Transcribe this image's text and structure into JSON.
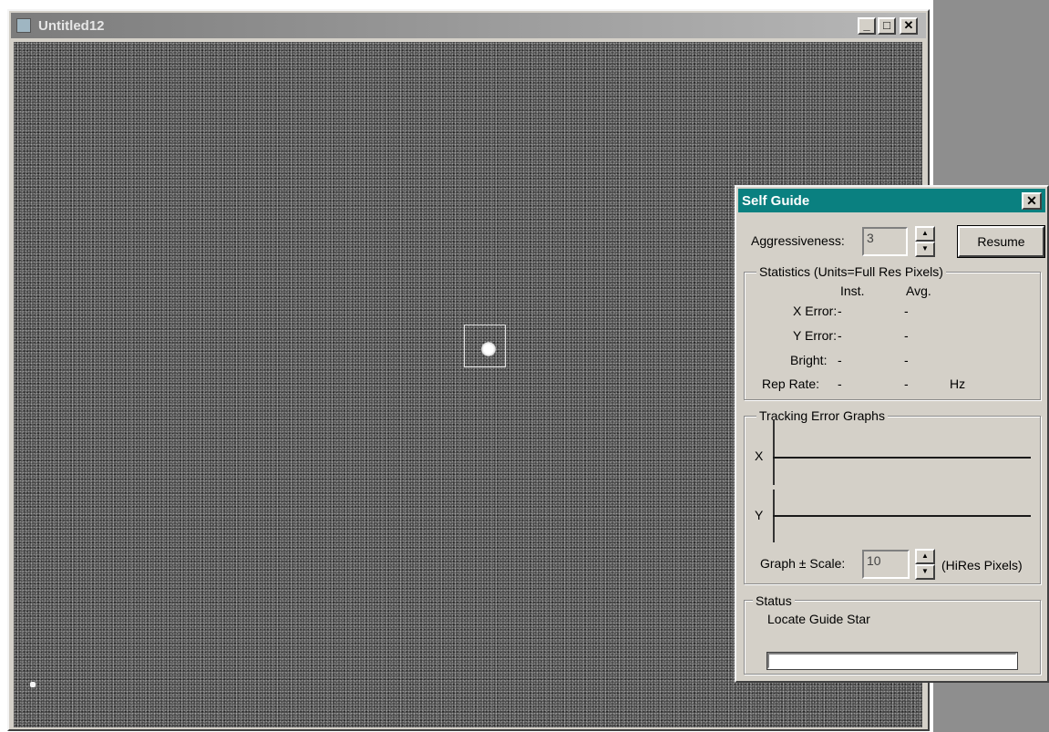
{
  "image_window": {
    "title": "Untitled12",
    "buttons": {
      "minimize": "_",
      "maximize": "□",
      "close": "✕"
    }
  },
  "self_guide": {
    "title": "Self Guide",
    "close": "✕",
    "aggressiveness": {
      "label": "Aggressiveness:",
      "value": "3"
    },
    "resume_label": "Resume",
    "statistics": {
      "group_label": "Statistics (Units=Full Res Pixels)",
      "col_inst": "Inst.",
      "col_avg": "Avg.",
      "rows": [
        {
          "label": "X Error:",
          "inst": "-",
          "avg": "-",
          "unit": ""
        },
        {
          "label": "Y Error:",
          "inst": "-",
          "avg": "-",
          "unit": ""
        },
        {
          "label": "Bright:",
          "inst": "-",
          "avg": "-",
          "unit": ""
        },
        {
          "label": "Rep Rate:",
          "inst": "-",
          "avg": "-",
          "unit": "Hz"
        }
      ]
    },
    "tracking": {
      "group_label": "Tracking Error Graphs",
      "x_label": "X",
      "y_label": "Y",
      "scale_label": "Graph ± Scale:",
      "scale_value": "10",
      "scale_unit": "(HiRes Pixels)"
    },
    "status": {
      "group_label": "Status",
      "text": "Locate Guide Star",
      "progress": 0
    }
  }
}
